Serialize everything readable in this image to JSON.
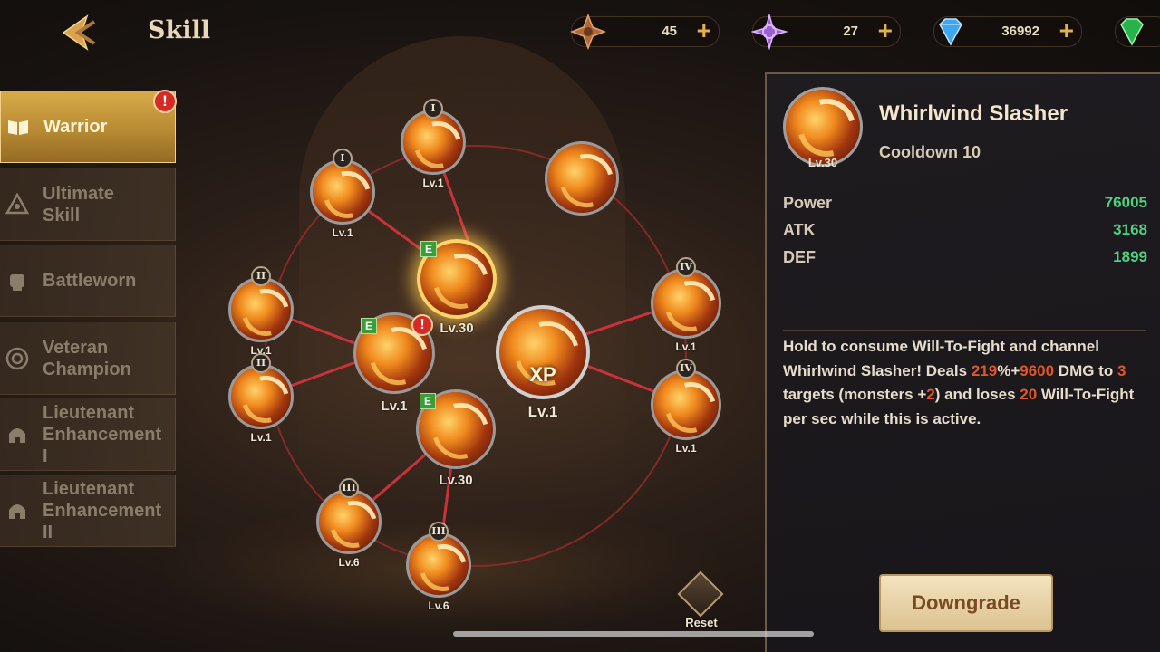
{
  "header": {
    "title": "Skill",
    "back_icon": "back-arrow-icon"
  },
  "currencies": [
    {
      "icon": "bronze-star-icon",
      "amount": "45",
      "plus": "+",
      "color": "#b06a3a"
    },
    {
      "icon": "purple-compass-icon",
      "amount": "27",
      "plus": "+",
      "color": "#9a5fd0"
    },
    {
      "icon": "blue-diamond-icon",
      "amount": "36992",
      "plus": "+",
      "color": "#3fa6f0"
    },
    {
      "icon": "green-gem-icon",
      "color": "#28b24a"
    }
  ],
  "sidebar": {
    "tabs": [
      {
        "label": "Warrior",
        "icon": "book-icon",
        "active": true,
        "alert": "!"
      },
      {
        "label": "Ultimate\nSkill",
        "icon": "hooded-head-icon",
        "active": false
      },
      {
        "label": "Battleworn",
        "icon": "fist-icon",
        "active": false
      },
      {
        "label": "Veteran\nChampion",
        "icon": "target-ring-icon",
        "active": false
      },
      {
        "label": "Lieutenant\nEnhancement\nI",
        "icon": "helmet-icon",
        "active": false
      },
      {
        "label": "Lieutenant\nEnhancement\nII",
        "icon": "helmet-icon",
        "active": false
      }
    ]
  },
  "tree": {
    "nodes": {
      "n1": {
        "rank": "I",
        "level": "Lv.1"
      },
      "n2": {
        "rank": "I",
        "level": "Lv.1"
      },
      "n3": {
        "level": ""
      },
      "n4": {
        "rank": "II",
        "level": "Lv.1"
      },
      "n5": {
        "rank": "II",
        "level": "Lv.1"
      },
      "n6": {
        "badge": "E",
        "level": "Lv.30"
      },
      "n7": {
        "badge": "E",
        "alert": "!",
        "level": "Lv.1"
      },
      "n8": {
        "label": "XP",
        "level": "Lv.1"
      },
      "n9": {
        "rank": "IV",
        "level": "Lv.1"
      },
      "n10": {
        "rank": "IV",
        "level": "Lv.1"
      },
      "n11": {
        "badge": "E",
        "level": "Lv.30"
      },
      "n12": {
        "rank": "III",
        "level": "Lv.6"
      },
      "n13": {
        "rank": "III",
        "level": "Lv.6"
      }
    },
    "link_color": "#c8333a",
    "reset_label": "Reset"
  },
  "detail": {
    "name": "Whirlwind Slasher",
    "cooldown": "Cooldown 10",
    "level": "Lv.30",
    "stats": [
      {
        "label": "Power",
        "value": "76005"
      },
      {
        "label": "ATK",
        "value": "3168"
      },
      {
        "label": "DEF",
        "value": "1899"
      }
    ],
    "desc": {
      "t1": "Hold to consume Will-To-Fight and channel Whirlwind Slasher! Deals ",
      "v1": "219",
      "t2": "%+",
      "v2": "9600",
      "t3": " DMG to ",
      "v3": "3",
      "t4": " targets (monsters +",
      "v4": "2",
      "t5": ") and loses ",
      "v5": "20",
      "t6": " Will-To-Fight per sec while this is active."
    },
    "highlight_color": "#e2562c",
    "stat_color": "#4fd17f",
    "downgrade_label": "Downgrade"
  }
}
